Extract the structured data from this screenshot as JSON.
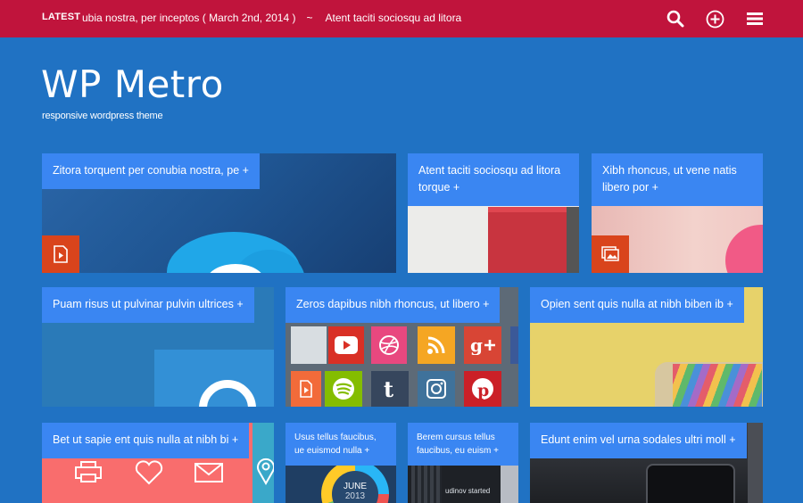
{
  "topbar": {
    "latest_label": "LATEST",
    "ticker_items": [
      "ubia nostra, per inceptos ( March 2nd, 2014 )",
      "~",
      "Atent taciti sociosqu ad litora"
    ],
    "icons": [
      "search-icon",
      "add-circle-icon",
      "menu-icon"
    ]
  },
  "brand": {
    "title": "WP Metro",
    "tagline": "responsive wordpress theme"
  },
  "tiles": [
    {
      "label": "Zitora torquent per conubia nostra, pe +"
    },
    {
      "label": "Atent taciti sociosqu ad litora torque +"
    },
    {
      "label": "Xibh rhoncus, ut vene natis libero por +"
    },
    {
      "label": "Puam risus ut pulvinar pulvin ultrices +"
    },
    {
      "label": "Zeros dapibus nibh rhoncus, ut libero +"
    },
    {
      "label": "Opien sent quis nulla at nibh biben ib +"
    },
    {
      "label": "Bet ut sapie ent quis nulla at nibh bi +"
    },
    {
      "label": "Usus tellus faucibus, ue euismod nulla +"
    },
    {
      "label": "Berem cursus tellus faucibus, eu euism +"
    },
    {
      "label": "Edunt enim vel urna sodales ultri moll +"
    }
  ],
  "calendar": {
    "month": "JUNE",
    "year": "2013"
  },
  "post_fragment": "udinov started",
  "colors": {
    "page_bg": "#2072c3",
    "topbar_bg": "#c0143c",
    "label_bg": "#3a86f2",
    "badge_bg": "#d9441c"
  }
}
